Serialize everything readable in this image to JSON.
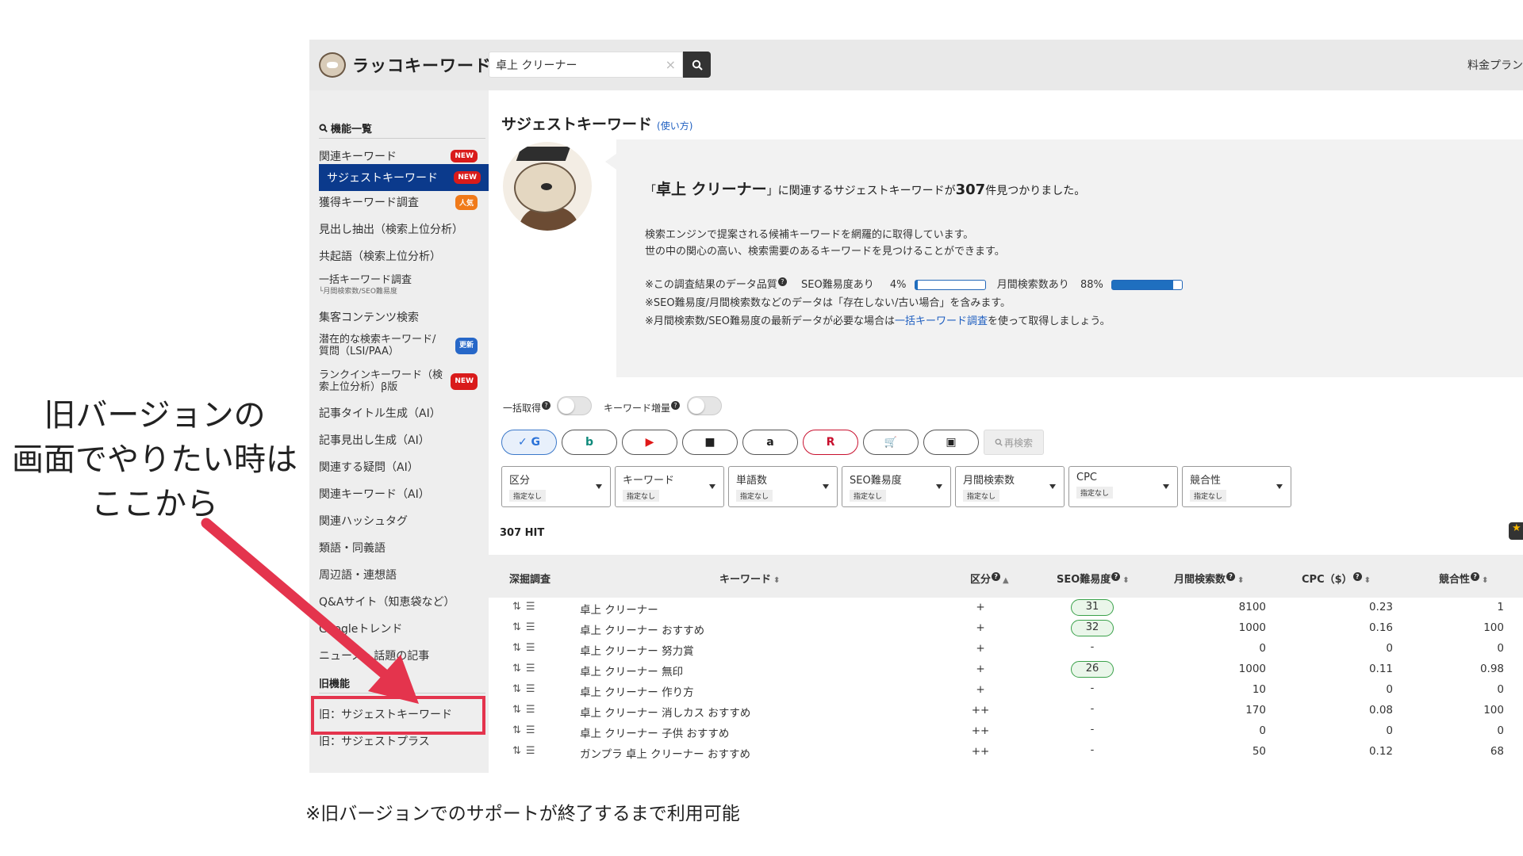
{
  "app": {
    "logo_text": "ラッコキーワード",
    "search_value": "卓上 クリーナー",
    "search_clear": "×",
    "search_icon": "search-icon",
    "pricing_label": "料金プラン"
  },
  "sidebar": {
    "header": "機能一覧",
    "items": [
      {
        "label": "関連キーワード",
        "badge": "NEW"
      },
      {
        "label": "サジェストキーワード",
        "badge": "NEW"
      },
      {
        "label": "獲得キーワード調査",
        "badge": "人気"
      },
      {
        "label": "見出し抽出（検索上位分析）"
      },
      {
        "label": "共起語（検索上位分析）"
      },
      {
        "label": "一括キーワード調査",
        "sub": "└月間検索数/SEO難易度"
      },
      {
        "label": "集客コンテンツ検索"
      },
      {
        "label": "潜在的な検索キーワード/質問（LSI/PAA）",
        "badge": "更新"
      },
      {
        "label": "ランクインキーワード（検索上位分析）β版",
        "badge": "NEW"
      },
      {
        "label": "記事タイトル生成（AI）"
      },
      {
        "label": "記事見出し生成（AI）"
      },
      {
        "label": "関連する疑問（AI）"
      },
      {
        "label": "関連キーワード（AI）"
      },
      {
        "label": "関連ハッシュタグ"
      },
      {
        "label": "類語・同義語"
      },
      {
        "label": "周辺語・連想語"
      },
      {
        "label": "Q&Aサイト（知恵袋など）"
      },
      {
        "label": "Googleトレンド"
      },
      {
        "label": "ニュース・話題の記事"
      }
    ],
    "legacy_header": "旧機能",
    "legacy_items": [
      "旧：サジェストキーワード",
      "旧：サジェストプラス"
    ]
  },
  "main": {
    "title": "サジェストキーワード",
    "how_to": "(使い方)",
    "lead_prefix": "「",
    "lead_keyword": "卓上 クリーナー",
    "lead_mid": "」に関連するサジェストキーワードが",
    "lead_count": "307",
    "lead_suffix": "件見つかりました。",
    "desc1": "検索エンジンで提案される候補キーワードを網羅的に取得しています。",
    "desc2": "世の中の関心の高い、検索需要のあるキーワードを見つけることができます。",
    "quality_label": "※この調査結果のデータ品質",
    "seo_label": "SEO難易度あり",
    "seo_pct_text": "4%",
    "seo_pct": 4,
    "volume_label": "月間検索数あり",
    "volume_pct_text": "88%",
    "volume_pct": 88,
    "note1": "※SEO難易度/月間検索数などのデータは「存在しない/古い場合」を含みます。",
    "note2_prefix": "※月間検索数/SEO難易度の最新データが必要な場合は",
    "note2_link": "一括キーワード調査",
    "note2_suffix": "を使って取得しましょう。",
    "toggle1": "一括取得",
    "toggle2": "キーワード増量",
    "engines": [
      "✓ G",
      "b",
      "▶",
      "■",
      "a",
      "R",
      "🛒",
      "▣"
    ],
    "research_btn": "再検索",
    "filters": [
      {
        "label": "区分",
        "value": "指定なし"
      },
      {
        "label": "キーワード",
        "value": "指定なし"
      },
      {
        "label": "単語数",
        "value": "指定なし"
      },
      {
        "label": "SEO難易度",
        "value": "指定なし"
      },
      {
        "label": "月間検索数",
        "value": "指定なし"
      },
      {
        "label": "CPC",
        "value": "指定なし"
      },
      {
        "label": "競合性",
        "value": "指定なし"
      }
    ],
    "hits": "307 HIT"
  },
  "table": {
    "headers": [
      "深掘調査",
      "キーワード",
      "区分",
      "SEO難易度",
      "月間検索数",
      "CPC（$）",
      "競合性"
    ],
    "rows": [
      {
        "keyword": "卓上 クリーナー",
        "kubun": "+",
        "seo": "31",
        "volume": "8100",
        "cpc": "0.23",
        "comp": "1"
      },
      {
        "keyword": "卓上 クリーナー おすすめ",
        "kubun": "+",
        "seo": "32",
        "volume": "1000",
        "cpc": "0.16",
        "comp": "100"
      },
      {
        "keyword": "卓上 クリーナー 努力賞",
        "kubun": "+",
        "seo": "-",
        "volume": "0",
        "cpc": "0",
        "comp": "0"
      },
      {
        "keyword": "卓上 クリーナー 無印",
        "kubun": "+",
        "seo": "26",
        "volume": "1000",
        "cpc": "0.11",
        "comp": "0.98"
      },
      {
        "keyword": "卓上 クリーナー 作り方",
        "kubun": "+",
        "seo": "-",
        "volume": "10",
        "cpc": "0",
        "comp": "0"
      },
      {
        "keyword": "卓上 クリーナー 消しカス おすすめ",
        "kubun": "++",
        "seo": "-",
        "volume": "170",
        "cpc": "0.08",
        "comp": "100"
      },
      {
        "keyword": "卓上 クリーナー 子供 おすすめ",
        "kubun": "++",
        "seo": "-",
        "volume": "0",
        "cpc": "0",
        "comp": "0"
      },
      {
        "keyword": "ガンプラ 卓上 クリーナー おすすめ",
        "kubun": "++",
        "seo": "-",
        "volume": "50",
        "cpc": "0.12",
        "comp": "68"
      }
    ]
  },
  "annotation": {
    "callout": "旧バージョンの\n画面でやりたい時は\nここから",
    "footnote": "※旧バージョンでのサポートが終了するまで利用可能",
    "color": "#e4344d"
  }
}
